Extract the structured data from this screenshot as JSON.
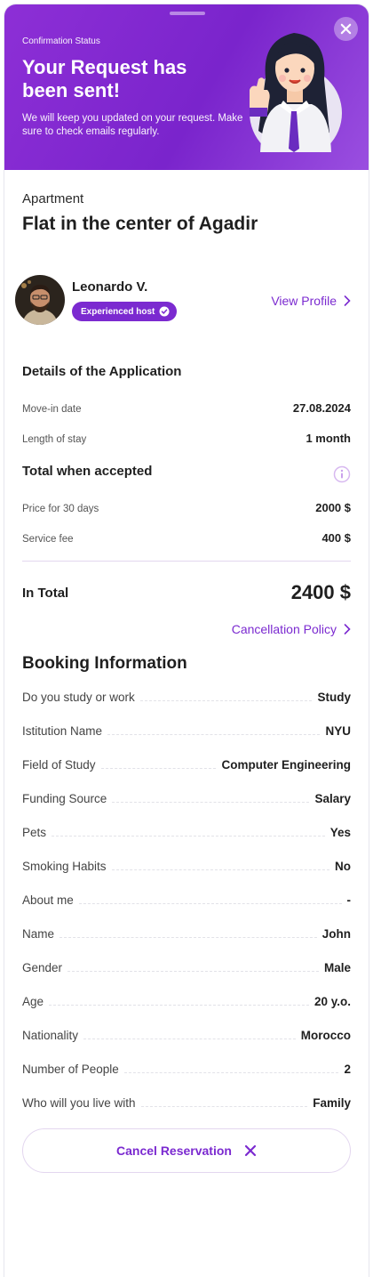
{
  "header": {
    "status_label": "Confirmation Status",
    "title": "Your Request has been sent!",
    "description": "We will keep you updated on your request. Make sure to check emails regularly."
  },
  "property": {
    "type": "Apartment",
    "title": "Flat in the center of Agadir"
  },
  "host": {
    "name": "Leonardo V.",
    "badge": "Experienced host",
    "view_profile": "View Profile"
  },
  "application": {
    "title": "Details of the Application",
    "rows": [
      {
        "label": "Move-in date",
        "value": "27.08.2024"
      },
      {
        "label": "Length of stay",
        "value": "1 month"
      }
    ]
  },
  "pricing": {
    "title": "Total when accepted",
    "rows": [
      {
        "label": "Price for 30 days",
        "value": "2000 $"
      },
      {
        "label": "Service fee",
        "value": "400 $"
      }
    ],
    "total_label": "In Total",
    "total_value": "2400 $",
    "cancellation_policy": "Cancellation Policy"
  },
  "booking": {
    "title": "Booking Information",
    "rows": [
      {
        "label": "Do you study or work",
        "value": "Study"
      },
      {
        "label": "Istitution Name",
        "value": "NYU"
      },
      {
        "label": "Field of Study",
        "value": "Computer Engineering"
      },
      {
        "label": "Funding Source",
        "value": "Salary"
      },
      {
        "label": "Pets",
        "value": "Yes"
      },
      {
        "label": "Smoking Habits",
        "value": "No"
      },
      {
        "label": "About me",
        "value": "-"
      },
      {
        "label": "Name",
        "value": "John"
      },
      {
        "label": "Gender",
        "value": "Male"
      },
      {
        "label": "Age",
        "value": "20 y.o."
      },
      {
        "label": "Nationality",
        "value": "Morocco"
      },
      {
        "label": "Number of People",
        "value": "2"
      },
      {
        "label": "Who will you live with",
        "value": "Family"
      }
    ]
  },
  "actions": {
    "cancel_reservation": "Cancel Reservation"
  },
  "colors": {
    "accent": "#7b2ad0",
    "header_gradient_start": "#8d2fd6",
    "header_gradient_end": "#9a4fe0"
  },
  "icons": [
    "close-icon",
    "verified-check-icon",
    "chevron-right-icon",
    "info-icon",
    "x-icon"
  ]
}
